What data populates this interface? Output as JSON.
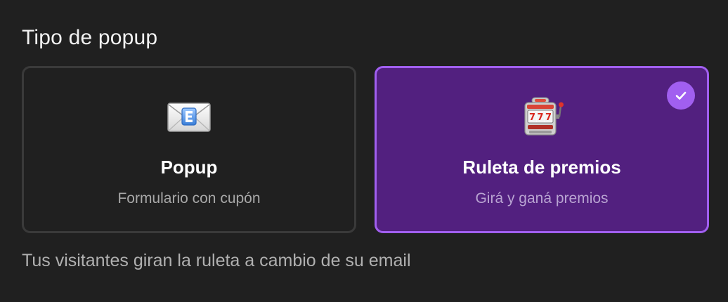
{
  "section": {
    "title": "Tipo de popup",
    "helper_text": "Tus visitantes giran la ruleta a cambio de su email"
  },
  "options": [
    {
      "icon": "envelope-icon",
      "title": "Popup",
      "subtitle": "Formulario con cupón",
      "selected": false
    },
    {
      "icon": "slot-machine-icon",
      "title": "Ruleta de premios",
      "subtitle": "Girá y ganá premios",
      "selected": true
    }
  ],
  "colors": {
    "background": "#202020",
    "selected_card": "#52207f",
    "accent": "#a15ff0",
    "card_border": "#3a3a3a"
  }
}
